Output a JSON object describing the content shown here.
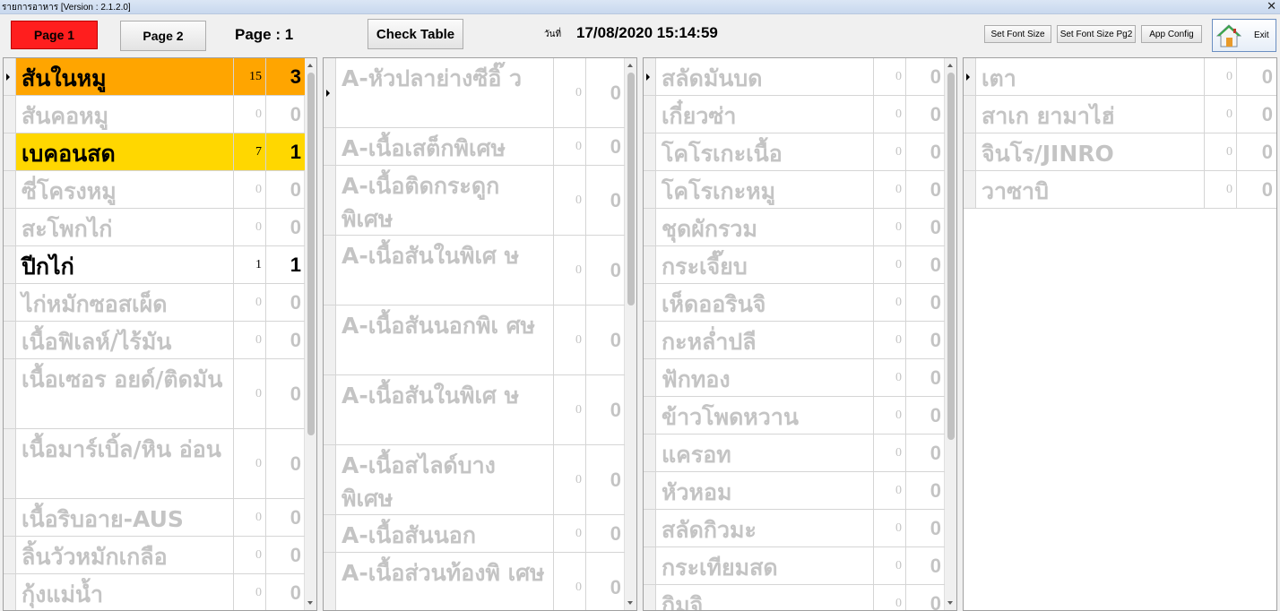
{
  "window": {
    "title": "รายการอาหาร [Version : 2.1.2.0]",
    "close_glyph": "✕"
  },
  "toolbar": {
    "page1": "Page 1",
    "page2": "Page 2",
    "page_label": "Page : 1",
    "check_table": "Check Table",
    "date_caption": "วันที่",
    "datetime": "17/08/2020 15:14:59",
    "set_font": "Set Font Size",
    "set_font_pg2": "Set Font Size Pg2",
    "app_config": "App Config",
    "exit": "Exit",
    "exit_icon": "house-icon",
    "page1_color": "#ff1e1e"
  },
  "colors": {
    "ordered_orange": "#ffa500",
    "ordered_yellow": "#ffd700",
    "inactive_text": "#c4c4c4"
  },
  "panels": [
    {
      "items": [
        {
          "name": "สันในหมู",
          "qty": "15",
          "count": "3",
          "style": "orange",
          "current": true
        },
        {
          "name": "สันคอหมู",
          "qty": "0",
          "count": "0",
          "style": ""
        },
        {
          "name": "เบคอนสด",
          "qty": "7",
          "count": "1",
          "style": "yellow"
        },
        {
          "name": "ซี่โครงหมู",
          "qty": "0",
          "count": "0",
          "style": ""
        },
        {
          "name": "สะโพกไก่",
          "qty": "0",
          "count": "0",
          "style": ""
        },
        {
          "name": "ปีกไก่",
          "qty": "1",
          "count": "1",
          "style": "black"
        },
        {
          "name": "ไก่หมักซอสเผ็ด",
          "qty": "0",
          "count": "0",
          "style": ""
        },
        {
          "name": "เนื้อฟิเลห์/ไร้มัน",
          "qty": "0",
          "count": "0",
          "style": ""
        },
        {
          "name": "เนื้อเซอร อยด์/ติดมัน",
          "qty": "0",
          "count": "0",
          "style": "",
          "tall": true
        },
        {
          "name": "เนื้อมาร์เบิ้ล/หิน อ่อน",
          "qty": "0",
          "count": "0",
          "style": "",
          "tall": true
        },
        {
          "name": "เนื้อริบอาย-AUS",
          "qty": "0",
          "count": "0",
          "style": ""
        },
        {
          "name": "ลิ้นวัวหมักเกลือ",
          "qty": "0",
          "count": "0",
          "style": ""
        },
        {
          "name": "กุ้งแม่น้ำ",
          "qty": "0",
          "count": "0",
          "style": ""
        }
      ]
    },
    {
      "items": [
        {
          "name": "A-หัวปลาย่างซีอิ๊ ว",
          "qty": "0",
          "count": "0",
          "style": "",
          "tall": true,
          "current": true
        },
        {
          "name": "A-เนื้อเสต็กพิเศษ",
          "qty": "0",
          "count": "0",
          "style": ""
        },
        {
          "name": "A-เนื้อติดกระดูก พิเศษ",
          "qty": "0",
          "count": "0",
          "style": "",
          "tall": true
        },
        {
          "name": "A-เนื้อสันในพิเศ ษ",
          "qty": "0",
          "count": "0",
          "style": "",
          "tall": true
        },
        {
          "name": "A-เนื้อสันนอกพิเ ศษ",
          "qty": "0",
          "count": "0",
          "style": "",
          "tall": true
        },
        {
          "name": "A-เนื้อสันในพิเศ ษ",
          "qty": "0",
          "count": "0",
          "style": "",
          "tall": true
        },
        {
          "name": "A-เนื้อสไลด์บาง พิเศษ",
          "qty": "0",
          "count": "0",
          "style": "",
          "tall": true
        },
        {
          "name": "A-เนื้อสันนอก",
          "qty": "0",
          "count": "0",
          "style": ""
        },
        {
          "name": "A-เนื้อส่วนท้องพิ เศษ",
          "qty": "0",
          "count": "0",
          "style": "",
          "tall": true
        }
      ]
    },
    {
      "items": [
        {
          "name": "สลัดมันบด",
          "qty": "0",
          "count": "0",
          "style": "",
          "current": true
        },
        {
          "name": "เกี๋ยวซ่า",
          "qty": "0",
          "count": "0",
          "style": ""
        },
        {
          "name": "โคโรเกะเนื้อ",
          "qty": "0",
          "count": "0",
          "style": ""
        },
        {
          "name": "โคโรเกะหมู",
          "qty": "0",
          "count": "0",
          "style": ""
        },
        {
          "name": "ชุดผักรวม",
          "qty": "0",
          "count": "0",
          "style": ""
        },
        {
          "name": "กระเจี๊ยบ",
          "qty": "0",
          "count": "0",
          "style": ""
        },
        {
          "name": "เห็ดออรินจิ",
          "qty": "0",
          "count": "0",
          "style": ""
        },
        {
          "name": "กะหล่ำปลี",
          "qty": "0",
          "count": "0",
          "style": ""
        },
        {
          "name": "ฟักทอง",
          "qty": "0",
          "count": "0",
          "style": ""
        },
        {
          "name": "ข้าวโพดหวาน",
          "qty": "0",
          "count": "0",
          "style": ""
        },
        {
          "name": "แครอท",
          "qty": "0",
          "count": "0",
          "style": ""
        },
        {
          "name": "หัวหอม",
          "qty": "0",
          "count": "0",
          "style": ""
        },
        {
          "name": "สลัดกิวมะ",
          "qty": "0",
          "count": "0",
          "style": ""
        },
        {
          "name": "กระเทียมสด",
          "qty": "0",
          "count": "0",
          "style": ""
        },
        {
          "name": "กิมจิ",
          "qty": "0",
          "count": "0",
          "style": ""
        }
      ]
    },
    {
      "items": [
        {
          "name": "เตา",
          "qty": "0",
          "count": "0",
          "style": "",
          "current": true
        },
        {
          "name": "สาเก ยามาไฮ่",
          "qty": "0",
          "count": "0",
          "style": ""
        },
        {
          "name": "จินโร/JINRO",
          "qty": "0",
          "count": "0",
          "style": ""
        },
        {
          "name": "วาซาบิ",
          "qty": "0",
          "count": "0",
          "style": ""
        }
      ]
    }
  ]
}
